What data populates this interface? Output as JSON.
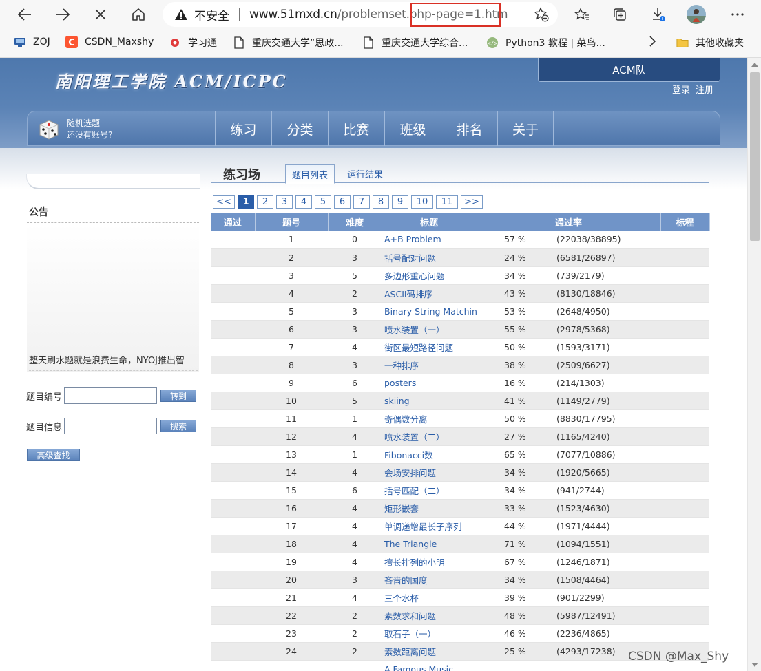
{
  "browser": {
    "insecure_label": "不安全",
    "url_host": "www.51mxd.cn",
    "url_path": "/problemset.php-page=1.htm",
    "bookmarks": [
      {
        "label": "ZOJ",
        "icon": "zoj-icon"
      },
      {
        "label": "CSDN_Maxshy",
        "icon": "csdn-icon"
      },
      {
        "label": "学习通",
        "icon": "chaoxing-icon"
      },
      {
        "label": "重庆交通大学“思政...",
        "icon": "page-icon"
      },
      {
        "label": "重庆交通大学综合...",
        "icon": "page-icon"
      },
      {
        "label": "Python3 教程 | 菜鸟...",
        "icon": "runoob-icon"
      }
    ],
    "other_bookmarks": "其他收藏夹"
  },
  "site": {
    "logo": "南阳理工学院 ACM/ICPC",
    "acm_tab": "ACM队",
    "login": "登录",
    "register": "注册",
    "random_title": "随机选题",
    "no_account": "还没有账号?",
    "menu": [
      "练习",
      "分类",
      "比赛",
      "班级",
      "排名",
      "关于"
    ]
  },
  "sidebar": {
    "notice_title": "公告",
    "notice_text": "整天刷水题就是浪费生命，NYOJ推出智",
    "search_id_label": "题目编号",
    "goto_button": "转到",
    "search_info_label": "题目信息",
    "search_button": "搜索",
    "advanced_button": "高级查找"
  },
  "main": {
    "page_title": "练习场",
    "tab_list": "题目列表",
    "tab_results": "运行结果",
    "pager": [
      "<<",
      "1",
      "2",
      "3",
      "4",
      "5",
      "6",
      "7",
      "8",
      "9",
      "10",
      "11",
      ">>"
    ],
    "active_page": "1",
    "columns": [
      "通过",
      "题号",
      "难度",
      "标题",
      "通过率",
      "标程"
    ],
    "rows": [
      {
        "id": "1",
        "diff": "0",
        "title": "A+B Problem",
        "rate": "57 %",
        "count": "(22038/38895)"
      },
      {
        "id": "2",
        "diff": "3",
        "title": "括号配对问题",
        "rate": "24 %",
        "count": "(6581/26897)"
      },
      {
        "id": "3",
        "diff": "5",
        "title": "多边形重心问题",
        "rate": "34 %",
        "count": "(739/2179)"
      },
      {
        "id": "4",
        "diff": "2",
        "title": "ASCII码排序",
        "rate": "43 %",
        "count": "(8130/18846)"
      },
      {
        "id": "5",
        "diff": "3",
        "title": "Binary String Matching",
        "rate": "53 %",
        "count": "(2648/4950)"
      },
      {
        "id": "6",
        "diff": "3",
        "title": "喷水装置（一）",
        "rate": "55 %",
        "count": "(2978/5368)"
      },
      {
        "id": "7",
        "diff": "4",
        "title": "街区最短路径问题",
        "rate": "50 %",
        "count": "(1593/3171)"
      },
      {
        "id": "8",
        "diff": "3",
        "title": "一种排序",
        "rate": "38 %",
        "count": "(2509/6627)"
      },
      {
        "id": "9",
        "diff": "6",
        "title": "posters",
        "rate": "16 %",
        "count": "(214/1303)"
      },
      {
        "id": "10",
        "diff": "5",
        "title": "skiing",
        "rate": "41 %",
        "count": "(1149/2779)"
      },
      {
        "id": "11",
        "diff": "1",
        "title": "奇偶数分离",
        "rate": "50 %",
        "count": "(8830/17795)"
      },
      {
        "id": "12",
        "diff": "4",
        "title": "喷水装置（二）",
        "rate": "27 %",
        "count": "(1165/4240)"
      },
      {
        "id": "13",
        "diff": "1",
        "title": "Fibonacci数",
        "rate": "65 %",
        "count": "(7077/10886)"
      },
      {
        "id": "14",
        "diff": "4",
        "title": "会场安排问题",
        "rate": "34 %",
        "count": "(1920/5665)"
      },
      {
        "id": "15",
        "diff": "6",
        "title": "括号匹配（二）",
        "rate": "34 %",
        "count": "(941/2744)"
      },
      {
        "id": "16",
        "diff": "4",
        "title": "矩形嵌套",
        "rate": "33 %",
        "count": "(1523/4630)"
      },
      {
        "id": "17",
        "diff": "4",
        "title": "单调递增最长子序列",
        "rate": "44 %",
        "count": "(1971/4444)"
      },
      {
        "id": "18",
        "diff": "4",
        "title": "The Triangle",
        "rate": "71 %",
        "count": "(1094/1551)"
      },
      {
        "id": "19",
        "diff": "4",
        "title": "擅长排列的小明",
        "rate": "67 %",
        "count": "(1246/1871)"
      },
      {
        "id": "20",
        "diff": "3",
        "title": "吝啬的国度",
        "rate": "34 %",
        "count": "(1508/4464)"
      },
      {
        "id": "21",
        "diff": "4",
        "title": "三个水杯",
        "rate": "39 %",
        "count": "(901/2299)"
      },
      {
        "id": "22",
        "diff": "2",
        "title": "素数求和问题",
        "rate": "48 %",
        "count": "(5987/12491)"
      },
      {
        "id": "23",
        "diff": "2",
        "title": "取石子（一）",
        "rate": "46 %",
        "count": "(2236/4865)"
      },
      {
        "id": "24",
        "diff": "2",
        "title": "素数距离问题",
        "rate": "25 %",
        "count": "(4293/17238)"
      },
      {
        "id": "",
        "diff": "",
        "title": "A Famous Music",
        "rate": "",
        "count": ""
      }
    ]
  },
  "watermark": "CSDN @Max_Shy",
  "colors": {
    "header_blue": "#5b83b6",
    "link_blue": "#2a5da8",
    "table_header": "#7094c8",
    "highlight_red": "#d93025"
  }
}
